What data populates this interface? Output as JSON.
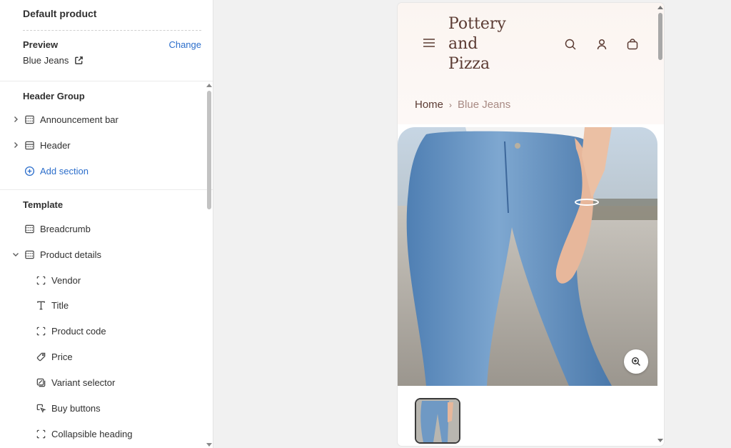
{
  "sidebar": {
    "title": "Default product",
    "preview_label": "Preview",
    "change_label": "Change",
    "preview_value": "Blue Jeans",
    "header_group_title": "Header Group",
    "header_group_items": [
      {
        "label": "Announcement bar",
        "icon": "section-icon",
        "expandable": true
      },
      {
        "label": "Header",
        "icon": "section-icon",
        "expandable": true
      }
    ],
    "add_section_label": "Add section",
    "template_title": "Template",
    "template_items": [
      {
        "label": "Breadcrumb",
        "icon": "section-icon"
      },
      {
        "label": "Product details",
        "icon": "section-icon",
        "expanded": true
      }
    ],
    "block_items": [
      {
        "label": "Vendor",
        "icon": "block-icon"
      },
      {
        "label": "Title",
        "icon": "text-icon"
      },
      {
        "label": "Product code",
        "icon": "block-icon"
      },
      {
        "label": "Price",
        "icon": "price-tag-icon"
      },
      {
        "label": "Variant selector",
        "icon": "variant-icon"
      },
      {
        "label": "Buy buttons",
        "icon": "cursor-icon"
      },
      {
        "label": "Collapsible heading",
        "icon": "block-icon"
      }
    ]
  },
  "preview": {
    "store_name_lines": [
      "Pottery",
      "and",
      "Pizza"
    ],
    "breadcrumb_home": "Home",
    "breadcrumb_separator": "›",
    "breadcrumb_current": "Blue Jeans"
  },
  "colors": {
    "accent": "#2c6ecb",
    "brand_text": "#5b3b33",
    "header_bg": "#fbf5f1"
  }
}
